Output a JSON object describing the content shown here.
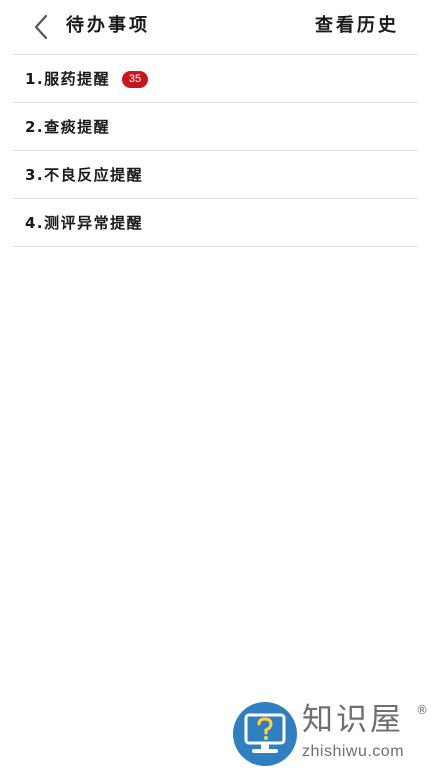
{
  "header": {
    "title": "待办事项",
    "history_label": "查看历史",
    "back_icon": "chevron-left-icon"
  },
  "list": {
    "items": [
      {
        "label": "1.服药提醒",
        "badge": "35"
      },
      {
        "label": "2.查痰提醒",
        "badge": ""
      },
      {
        "label": "3.不良反应提醒",
        "badge": ""
      },
      {
        "label": "4.测评异常提醒",
        "badge": ""
      }
    ]
  },
  "watermark": {
    "brand": "知识屋",
    "registered": "®",
    "url": "zhishiwu.com",
    "icon": "monitor-question-icon"
  },
  "colors": {
    "badge": "#c8161d",
    "divider": "#e3e3e3",
    "watermark_blue": "#2f7fc1",
    "watermark_text": "#6f6f6f"
  }
}
